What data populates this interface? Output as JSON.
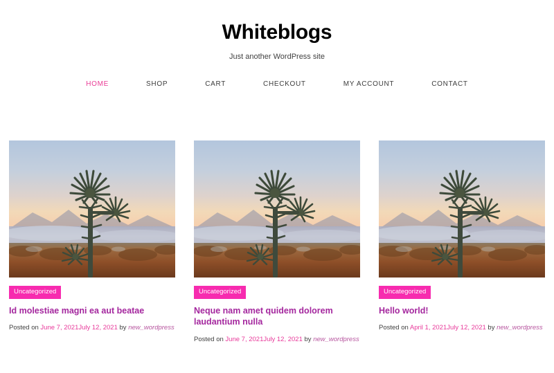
{
  "site": {
    "title": "Whiteblogs",
    "tagline": "Just another WordPress site"
  },
  "nav": {
    "items": [
      {
        "label": "HOME",
        "active": true
      },
      {
        "label": "SHOP",
        "active": false
      },
      {
        "label": "CART",
        "active": false
      },
      {
        "label": "CHECKOUT",
        "active": false
      },
      {
        "label": "MY ACCOUNT",
        "active": false
      },
      {
        "label": "CONTACT",
        "active": false
      }
    ]
  },
  "posts": [
    {
      "category": "Uncategorized",
      "title": "Id molestiae magni ea aut beatae",
      "meta_prefix": "Posted on ",
      "date_published": "June 7, 2021",
      "date_modified": "July 12, 2021",
      "meta_by": " by ",
      "author": "new_wordpress",
      "image_alt": "sunset-agave-plant-photo"
    },
    {
      "category": "Uncategorized",
      "title": "Neque nam amet quidem dolorem laudantium nulla",
      "meta_prefix": "Posted on ",
      "date_published": "June 7, 2021",
      "date_modified": "July 12, 2021",
      "meta_by": " by ",
      "author": "new_wordpress",
      "image_alt": "sunset-agave-plant-photo"
    },
    {
      "category": "Uncategorized",
      "title": "Hello world!",
      "meta_prefix": "Posted on ",
      "date_published": "April 1, 2021",
      "date_modified": "July 12, 2021",
      "meta_by": " by ",
      "author": "new_wordpress",
      "image_alt": "sunset-agave-plant-photo"
    }
  ],
  "colors": {
    "accent_pink": "#ea3c96",
    "badge_pink": "#f72baf",
    "title_purple": "#a4279e",
    "text_dark": "#3d3d3d",
    "background": "#ffffff"
  }
}
